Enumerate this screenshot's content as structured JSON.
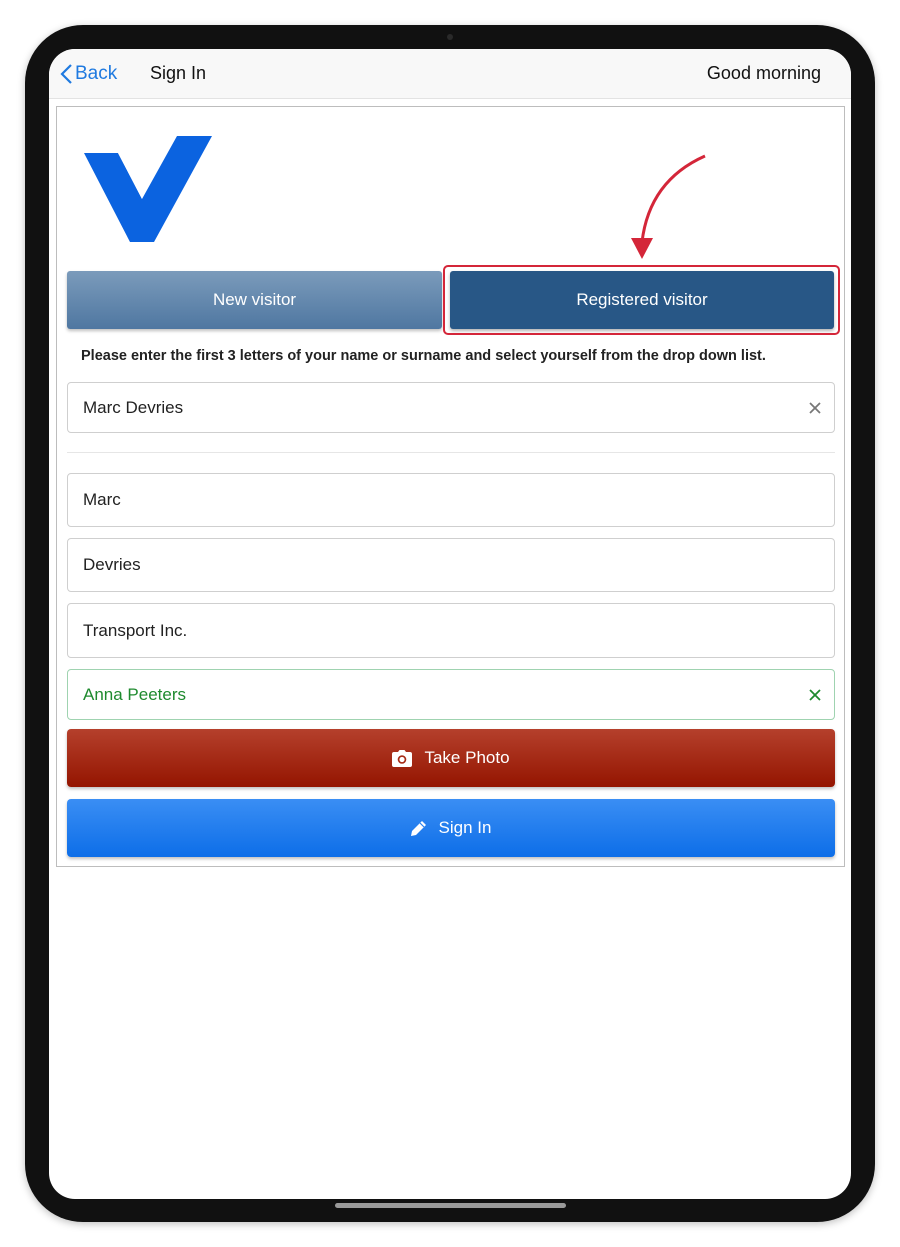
{
  "nav": {
    "back_label": "Back",
    "title": "Sign In",
    "greeting": "Good morning"
  },
  "tabs": {
    "new_visitor": "New visitor",
    "registered_visitor": "Registered visitor",
    "active": "registered_visitor"
  },
  "instruction": "Please enter the first 3 letters of your name or surname and select yourself from the drop down list.",
  "search": {
    "value": "Marc Devries"
  },
  "form": {
    "first_name": "Marc",
    "last_name": "Devries",
    "company": "Transport Inc.",
    "host": "Anna Peeters"
  },
  "buttons": {
    "take_photo": "Take Photo",
    "sign_in": "Sign In"
  },
  "icons": {
    "back": "chevron-left-icon",
    "clear": "close-icon",
    "photo": "camera-icon",
    "sign_in": "pencil-icon"
  },
  "colors": {
    "accent_blue": "#1f7ae0",
    "tab_active": "#285786",
    "tab_inactive": "#5f86ac",
    "photo_button": "#a52a15",
    "signin_button": "#2a82ef",
    "host_text": "#1e8a2e",
    "annotation_red": "#d42639",
    "logo_blue": "#0b63e0"
  }
}
